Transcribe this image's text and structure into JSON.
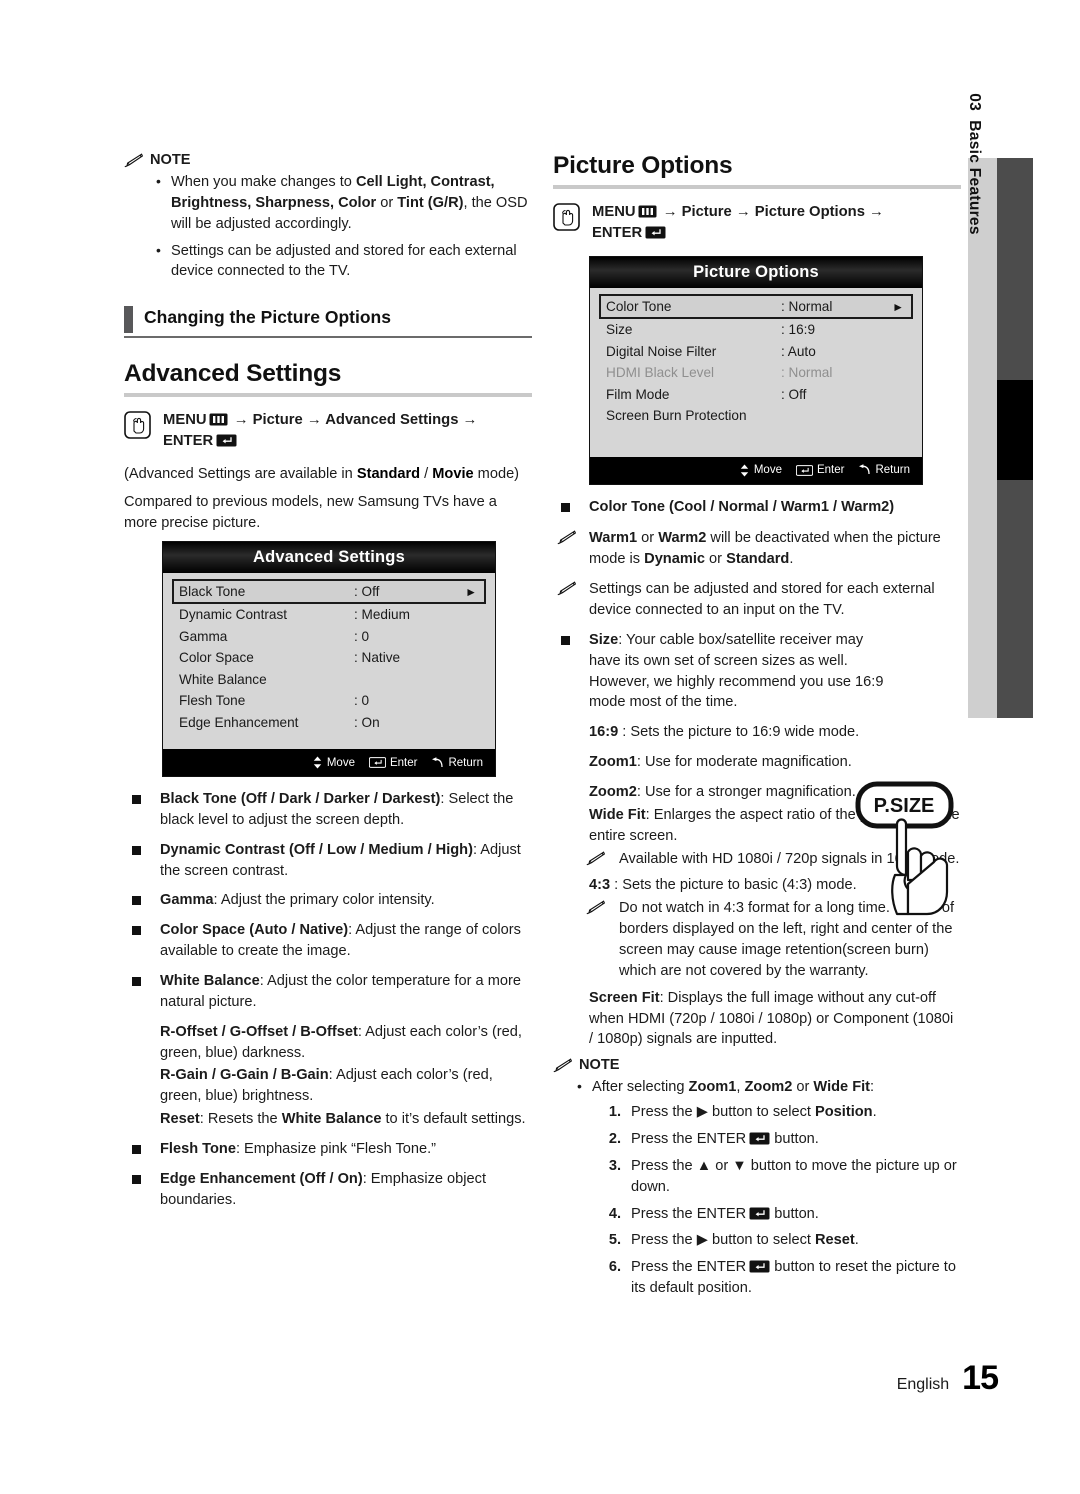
{
  "side_tab": {
    "chapter_number": "03",
    "chapter_title": "Basic Features"
  },
  "footer": {
    "language": "English",
    "page_number": "15"
  },
  "left_column": {
    "note_heading": "NOTE",
    "note_items": [
      "When you make changes to <b>Cell Light, Contrast, Brightness, Sharpness, Color</b> or <b>Tint (G/R)</b>, the OSD will be adjusted accordingly.",
      "Settings can be adjusted and stored for each external device connected to the TV."
    ],
    "subheading": "Changing the Picture Options",
    "section_title": "Advanced Settings",
    "menu_path": "MENU|m| → Picture → Advanced Settings → ENTER|e|",
    "intro_paragraphs": [
      "(Advanced Settings are available in <b>Standard</b> / <b>Movie</b> mode)",
      "Compared to previous models, new Samsung TVs have a more precise picture."
    ],
    "osd": {
      "title": "Advanced Settings",
      "rows": [
        {
          "label": "Black Tone",
          "value": ": Off",
          "selected": true,
          "dim": false
        },
        {
          "label": "Dynamic Contrast",
          "value": ": Medium",
          "selected": false,
          "dim": false
        },
        {
          "label": "Gamma",
          "value": ": 0",
          "selected": false,
          "dim": false
        },
        {
          "label": "Color Space",
          "value": ": Native",
          "selected": false,
          "dim": false
        },
        {
          "label": "White Balance",
          "value": "",
          "selected": false,
          "dim": false
        },
        {
          "label": "Flesh Tone",
          "value": ": 0",
          "selected": false,
          "dim": false
        },
        {
          "label": "Edge Enhancement",
          "value": ": On",
          "selected": false,
          "dim": false
        }
      ],
      "footer_keys": [
        "Move",
        "Enter",
        "Return"
      ]
    },
    "bullets": [
      "<b>Black Tone (Off / Dark / Darker / Darkest)</b>: Select the black level to adjust the screen depth.",
      "<b>Dynamic Contrast (Off / Low / Medium / High)</b>: Adjust the screen contrast.",
      "<b>Gamma</b>: Adjust the primary color intensity.",
      "<b>Color Space (Auto / Native)</b>: Adjust the range of colors available to create the image.",
      "<b>White Balance</b>: Adjust the color temperature for a more natural picture."
    ],
    "white_balance_subitems": [
      "<b>R-Offset / G-Offset / B-Offset</b>: Adjust each color’s (red, green, blue) darkness.",
      "<b>R-Gain / G-Gain / B-Gain</b>: Adjust each color’s (red, green, blue) brightness.",
      "<b>Reset</b>: Resets the <b>White Balance</b> to it’s default settings."
    ],
    "bullets_after": [
      "<b>Flesh Tone</b>: Emphasize pink “Flesh Tone.”",
      "<b>Edge Enhancement (Off / On)</b>: Emphasize object boundaries."
    ]
  },
  "right_column": {
    "section_title": "Picture Options",
    "menu_path": "MENU|m| → Picture → Picture Options → ENTER|e|",
    "osd": {
      "title": "Picture Options",
      "rows": [
        {
          "label": "Color Tone",
          "value": ": Normal",
          "selected": true,
          "dim": false
        },
        {
          "label": "Size",
          "value": ": 16:9",
          "selected": false,
          "dim": false
        },
        {
          "label": "Digital Noise Filter",
          "value": ": Auto",
          "selected": false,
          "dim": false
        },
        {
          "label": "HDMI Black Level",
          "value": ": Normal",
          "selected": false,
          "dim": true
        },
        {
          "label": "Film Mode",
          "value": ": Off",
          "selected": false,
          "dim": false
        },
        {
          "label": "Screen Burn Protection",
          "value": "",
          "selected": false,
          "dim": false
        }
      ],
      "footer_keys": [
        "Move",
        "Enter",
        "Return"
      ]
    },
    "color_tone_bullet": "<b>Color Tone (Cool / Normal / Warm1 / Warm2)</b>",
    "color_tone_notes": [
      "<b>Warm1</b> or <b>Warm2</b> will be deactivated when the picture mode is <b>Dynamic</b> or <b>Standard</b>.",
      "Settings can be adjusted and stored for each external device connected to an input on the TV."
    ],
    "size_bullet": "<b>Size</b>: Your cable box/satellite receiver may have its own set of screen sizes as well. However, we highly recommend you use 16:9 mode most of the time.",
    "psize_button_label": "P.SIZE",
    "size_modes": [
      "<b>16:9</b> : Sets the picture to 16:9 wide mode.",
      "<b>Zoom1</b>: Use for moderate magnification.",
      "<b>Zoom2</b>: Use for a stronger magnification.",
      "<b>Wide Fit</b>: Enlarges the aspect ratio of the picture to fit the entire screen."
    ],
    "wide_fit_note": "Available with HD 1080i / 720p signals in 16:9 mode.",
    "four_three": "<b>4:3</b> : Sets the picture to basic (4:3) mode.",
    "four_three_note": "Do not watch in 4:3 format for a long time. Traces of borders displayed on the left, right and center of the screen may cause image retention(screen burn) which are not covered by the warranty.",
    "screen_fit": "<b>Screen Fit</b>: Displays the full image without any cut-off when HDMI (720p / 1080i / 1080p) or Component (1080i / 1080p) signals are inputted.",
    "note_heading": "NOTE",
    "note_intro": "After selecting <b>Zoom1</b>, <b>Zoom2</b> or <b>Wide Fit</b>:",
    "steps": [
      "Press the ▶ button to select <b>Position</b>.",
      "Press the ENTER|e| button.",
      "Press the ▲ or ▼ button to move the picture up or down.",
      "Press the ENTER|e| button.",
      "Press the ▶ button to select <b>Reset</b>.",
      "Press the ENTER|e| button to reset the picture to its default position."
    ]
  },
  "colors": {
    "accent_bar": "#58585a",
    "rule_light": "#c9c9c9",
    "osd_body": "#d6d6d6",
    "side_tab": "#cfcfcf",
    "side_bar": "#4c4c4c"
  }
}
